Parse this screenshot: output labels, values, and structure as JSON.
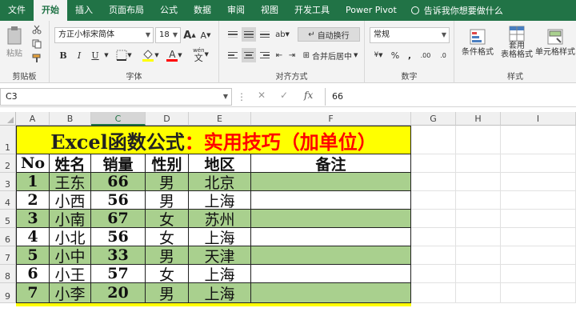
{
  "menu": {
    "items": [
      "文件",
      "开始",
      "插入",
      "页面布局",
      "公式",
      "数据",
      "审阅",
      "视图",
      "开发工具",
      "Power Pivot"
    ],
    "active_index": 1,
    "tell_me": "告诉我你想要做什么"
  },
  "ribbon": {
    "clipboard": {
      "label": "剪贴板",
      "paste": "粘贴"
    },
    "font": {
      "label": "字体",
      "font_name": "方正小标宋简体",
      "font_size": "18",
      "bold": "B",
      "italic": "I",
      "underline": "U",
      "grow": "A",
      "shrink": "A",
      "font_color_glyph": "A",
      "phonetic": "wén"
    },
    "alignment": {
      "label": "对齐方式",
      "wrap": "自动换行",
      "merge": "合并后居中"
    },
    "number": {
      "label": "数字",
      "format": "常规",
      "percent": "%",
      "comma": ",",
      "inc_decimal": ".00",
      "dec_decimal": ".0"
    },
    "styles": {
      "label": "样式",
      "conditional": "条件格式",
      "table_format": "套用\n表格格式",
      "cell_style": "单元格样式"
    }
  },
  "formula_bar": {
    "name_box": "C3",
    "cancel": "✕",
    "enter": "✓",
    "fx": "fx",
    "value": "66"
  },
  "grid": {
    "columns": [
      "A",
      "B",
      "C",
      "D",
      "E",
      "F",
      "G",
      "H",
      "I"
    ],
    "selected_column": "C",
    "rows": [
      "1",
      "2",
      "3",
      "4",
      "5",
      "6",
      "7",
      "8",
      "9"
    ],
    "title_black": "Excel函数公式",
    "title_red": "：实用技巧（加单位）",
    "headers": [
      "No",
      "姓名",
      "销量",
      "性别",
      "地区",
      "备注"
    ],
    "data": [
      [
        "1",
        "王东",
        "66",
        "男",
        "北京",
        ""
      ],
      [
        "2",
        "小西",
        "56",
        "男",
        "上海",
        ""
      ],
      [
        "3",
        "小南",
        "67",
        "女",
        "苏州",
        ""
      ],
      [
        "4",
        "小北",
        "56",
        "女",
        "上海",
        ""
      ],
      [
        "5",
        "小中",
        "33",
        "男",
        "天津",
        ""
      ],
      [
        "6",
        "小王",
        "57",
        "女",
        "上海",
        ""
      ],
      [
        "7",
        "小李",
        "20",
        "男",
        "上海",
        ""
      ]
    ]
  },
  "colors": {
    "excel_green": "#217346",
    "row_green": "#a9d08e",
    "title_yellow": "#ffff00",
    "title_red": "#ff0000"
  }
}
